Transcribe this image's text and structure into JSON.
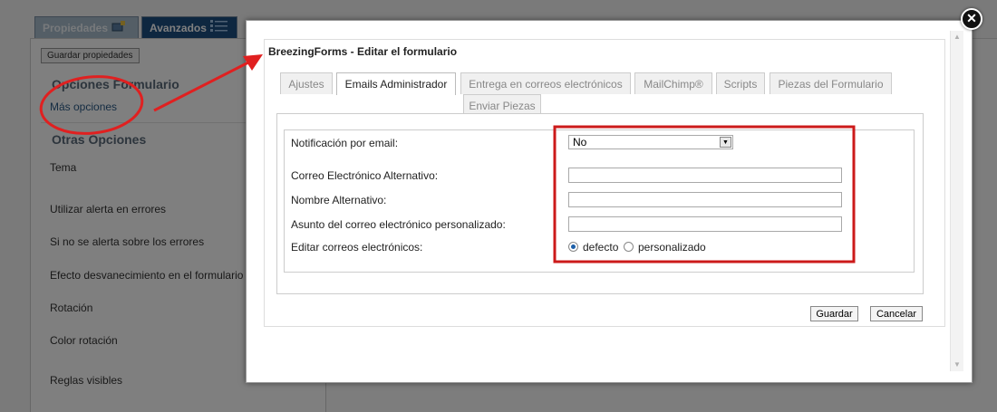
{
  "background": {
    "tabs": [
      "Propiedades",
      "Avanzados"
    ],
    "save_button": "Guardar propiedades",
    "section_options": "Opciones Formulario",
    "more_options_link": "Más opciones",
    "section_other": "Otras Opciones",
    "items": [
      "Tema",
      "Utilizar alerta en errores",
      "Si no se alerta sobre los errores",
      "Efecto desvanecimiento en el formulario",
      "Rotación",
      "Color rotación",
      "Reglas visibles"
    ]
  },
  "modal": {
    "title": "BreezingForms - Editar el formulario",
    "tabs": [
      "Ajustes",
      "Emails Administrador",
      "Entrega en correos electrónicos",
      "MailChimp®",
      "Scripts",
      "Piezas del Formulario",
      "Enviar Piezas"
    ],
    "active_tab": "Emails Administrador",
    "form": {
      "notification_label": "Notificación por email:",
      "notification_value": "No",
      "alt_email_label": "Correo Electrónico Alternativo:",
      "alt_email_value": "",
      "alt_name_label": "Nombre Alternativo:",
      "alt_name_value": "",
      "custom_subject_label": "Asunto del correo electrónico personalizado:",
      "custom_subject_value": "",
      "edit_emails_label": "Editar correos electrónicos:",
      "radio_default": "defecto",
      "radio_custom": "personalizado",
      "radio_selected": "defecto"
    },
    "save_button": "Guardar",
    "cancel_button": "Cancelar"
  },
  "icons": {
    "close": "close-icon",
    "tab_icons": [
      "properties-icon",
      "list-icon"
    ]
  },
  "colors": {
    "annotation": "#e02020",
    "accent": "#1d4f80"
  }
}
